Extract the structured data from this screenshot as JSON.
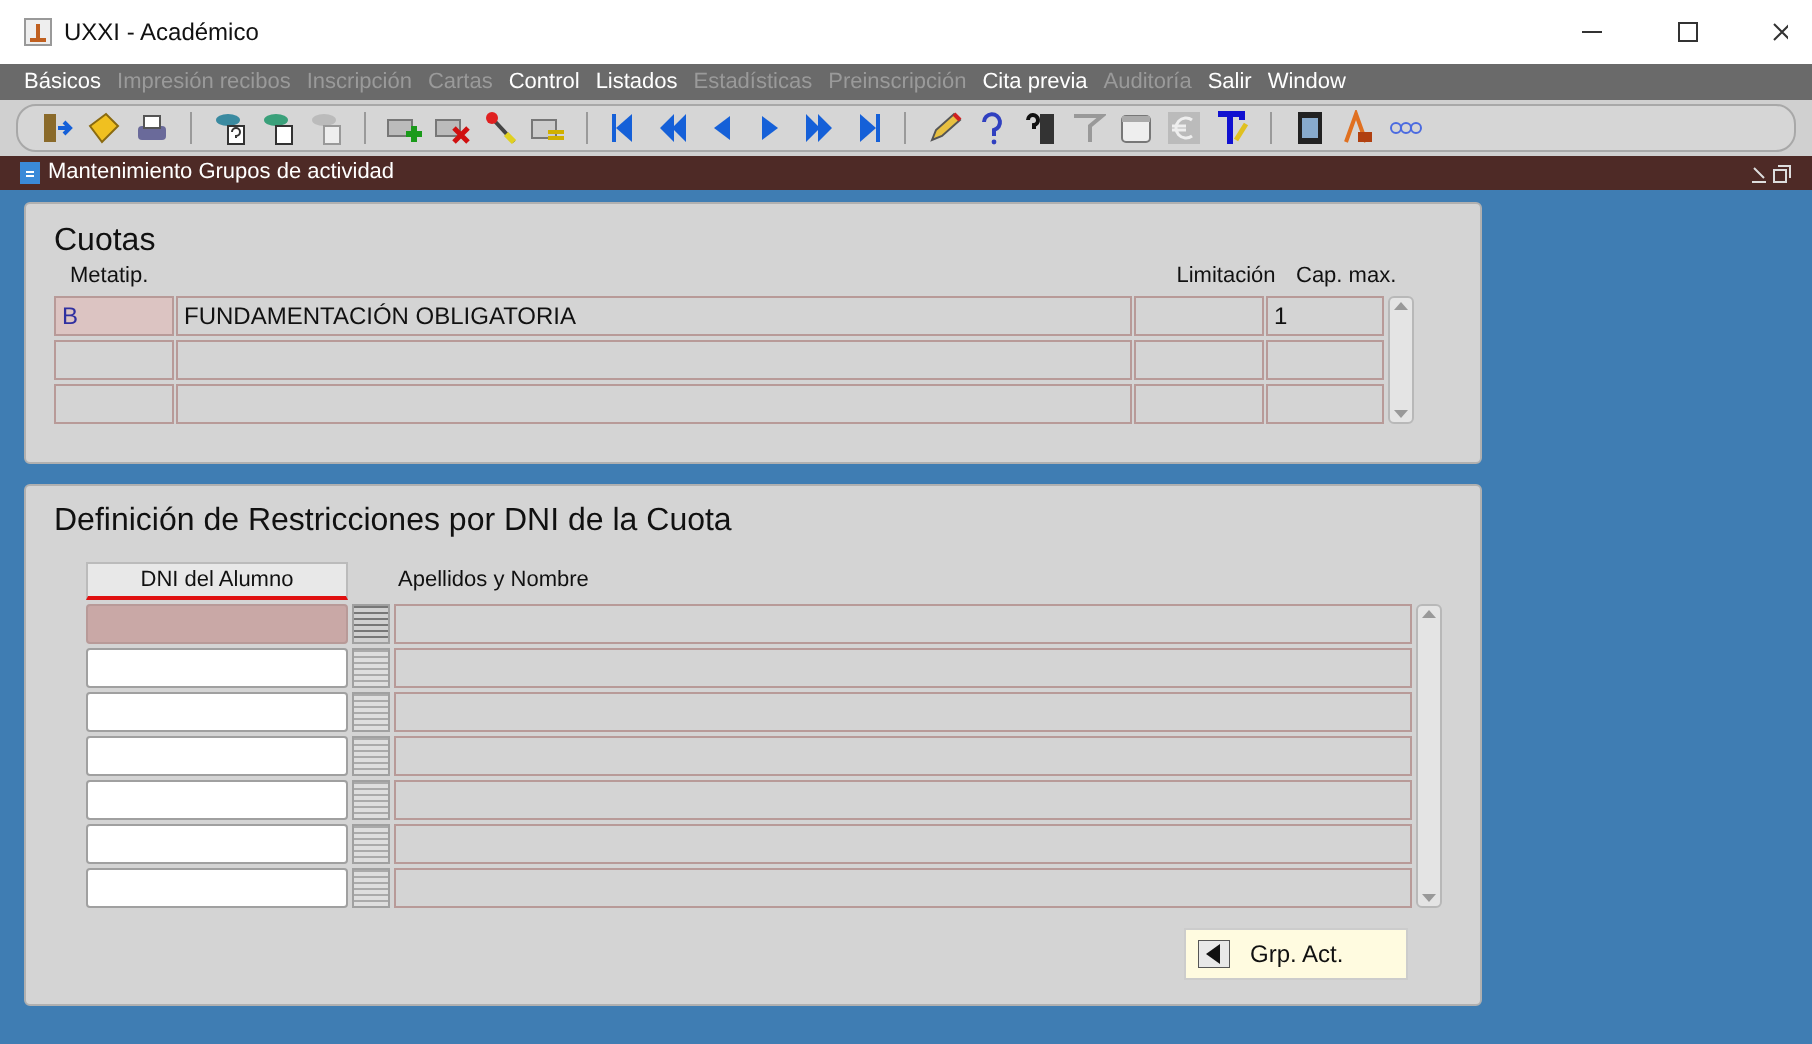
{
  "window": {
    "title": "UXXI - Académico"
  },
  "menu": [
    {
      "label": "Básicos",
      "disabled": false
    },
    {
      "label": "Impresión recibos",
      "disabled": true
    },
    {
      "label": "Inscripción",
      "disabled": true
    },
    {
      "label": "Cartas",
      "disabled": true
    },
    {
      "label": "Control",
      "disabled": false
    },
    {
      "label": "Listados",
      "disabled": false
    },
    {
      "label": "Estadísticas",
      "disabled": true
    },
    {
      "label": "Preinscripción",
      "disabled": true
    },
    {
      "label": "Cita previa",
      "disabled": false
    },
    {
      "label": "Auditoría",
      "disabled": true
    },
    {
      "label": "Salir",
      "disabled": false
    },
    {
      "label": "Window",
      "disabled": false
    }
  ],
  "form": {
    "title": "Mantenimiento Grupos de actividad"
  },
  "cuotas": {
    "title": "Cuotas",
    "columns": {
      "metatip": "Metatip.",
      "limitacion": "Limitación",
      "cap_max": "Cap. max."
    },
    "rows": [
      {
        "metatip": "B",
        "description": "FUNDAMENTACIÓN OBLIGATORIA",
        "cap_max": "1"
      }
    ]
  },
  "restricciones": {
    "title": "Definición de Restricciones por DNI de la Cuota",
    "columns": {
      "dni": "DNI del Alumno",
      "nombre": "Apellidos y Nombre"
    },
    "rows": [
      {
        "selected": true
      },
      {
        "selected": false
      },
      {
        "selected": false
      },
      {
        "selected": false
      },
      {
        "selected": false
      },
      {
        "selected": false
      },
      {
        "selected": false
      }
    ],
    "button": {
      "label": "Grp. Act."
    }
  }
}
